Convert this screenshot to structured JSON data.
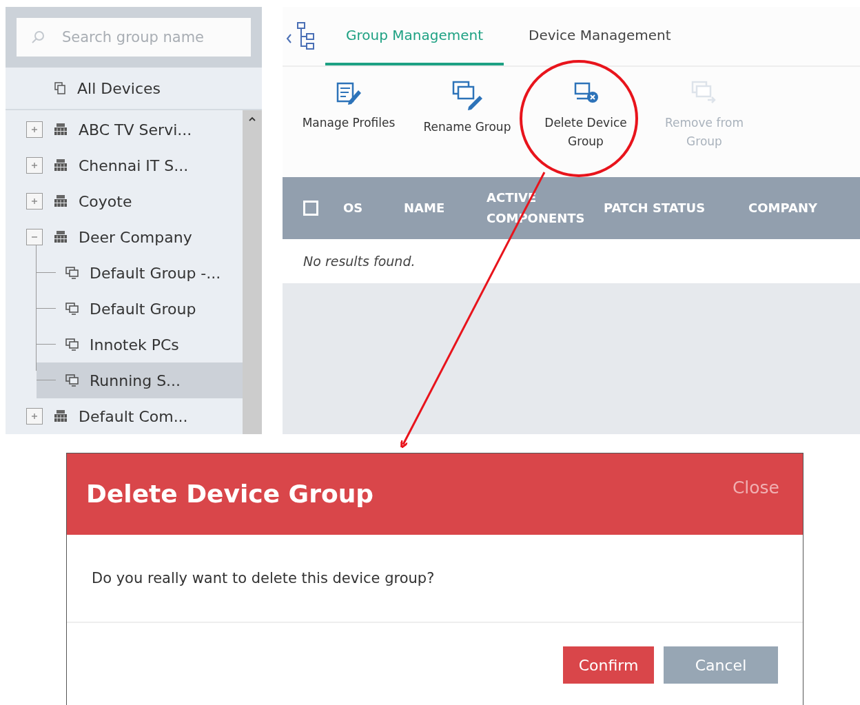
{
  "sidebar": {
    "search": {
      "placeholder": "Search group name"
    },
    "all_devices": "All Devices",
    "tree": [
      {
        "label": "ABC TV Servi...",
        "expanded": false,
        "selected": false
      },
      {
        "label": "Chennai IT S...",
        "expanded": false,
        "selected": false
      },
      {
        "label": "Coyote",
        "expanded": false,
        "selected": false
      },
      {
        "label": "Deer Company",
        "expanded": true,
        "selected": false,
        "children": [
          {
            "label": "Default Group -...",
            "selected": false
          },
          {
            "label": "Default Group",
            "selected": false
          },
          {
            "label": "Innotek PCs",
            "selected": false
          },
          {
            "label": "Running S...",
            "selected": true
          }
        ]
      },
      {
        "label": "Default Com...",
        "expanded": false,
        "selected": false
      }
    ]
  },
  "tabs": [
    {
      "label": "Group Management",
      "selected": true
    },
    {
      "label": "Device Management",
      "selected": false
    }
  ],
  "toolbar": [
    {
      "kind": "profiles",
      "label": "Manage Profiles",
      "disabled": false
    },
    {
      "kind": "rename",
      "label": "Rename Group",
      "disabled": false
    },
    {
      "kind": "delete",
      "label": "Delete Device Group",
      "disabled": false
    },
    {
      "kind": "remove",
      "label": "Remove from Group",
      "disabled": true
    }
  ],
  "table": {
    "select_all_checked": false,
    "columns": [
      "OS",
      "NAME",
      "ACTIVE COMPONENTS",
      "PATCH STATUS",
      "COMPANY"
    ],
    "empty_message": "No results found."
  },
  "dialog": {
    "title": "Delete Device Group",
    "close": "Close",
    "message": "Do you really want to delete this device group?",
    "buttons": [
      {
        "kind": "primary",
        "label": "Confirm"
      },
      {
        "kind": "secondary",
        "label": "Cancel"
      }
    ]
  }
}
